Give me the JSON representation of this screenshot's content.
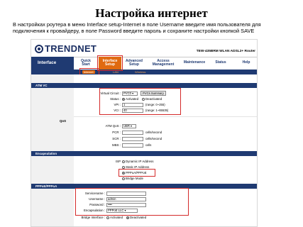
{
  "slide": {
    "title": "Настройка интернет",
    "description_line1": "В настройках роутера в меню Interface setup-Internet  в поле Username введите имя пользователя для",
    "description_line2": "подключения к  провайдеру, в поле Password  введите пароль и сохраните настройки кнопкой SAVE"
  },
  "router": {
    "brand": "TRENDNET",
    "model": "TEW-435BRM WLAN ADSL2+ Router",
    "nav_left": "Interface",
    "tabs": [
      {
        "label_line1": "Quick",
        "label_line2": "Start"
      },
      {
        "label_line1": "Interface",
        "label_line2": "Setup"
      },
      {
        "label_line1": "Advanced",
        "label_line2": "Setup"
      },
      {
        "label_line1": "Access",
        "label_line2": "Management"
      },
      {
        "label_line1": "Maintenance",
        "label_line2": ""
      },
      {
        "label_line1": "Status",
        "label_line2": ""
      },
      {
        "label_line1": "Help",
        "label_line2": ""
      }
    ],
    "subtabs": [
      "Internet",
      "LAN",
      "Wireless"
    ],
    "sections": {
      "atm_vc": "ATM VC",
      "qos": "QoS",
      "encapsulation": "Encapsulation",
      "pppoe": "PPPoE/PPPoA"
    },
    "atm": {
      "virtual_circuit_label": "Virtual Circuit :",
      "virtual_circuit_value": "PVC0",
      "pvcs_summary_button": "PVCs Summary",
      "status_label": "Status :",
      "status_activated": "Activated",
      "status_deactivated": "Deactivated",
      "vpi_label": "VPI :",
      "vpi_value": "1",
      "vpi_hint": "(range: 0~255)",
      "vci_label": "VCI :",
      "vci_value": "40",
      "vci_hint": "(range: 1~65535)"
    },
    "qos": {
      "atm_qos_label": "ATM QoS :",
      "atm_qos_value": "UBR",
      "pcr_label": "PCR :",
      "pcr_unit": "cells/second",
      "scr_label": "SCR :",
      "scr_unit": "cells/second",
      "mbs_label": "MBS :",
      "mbs_unit": "cells"
    },
    "encap": {
      "isp_label": "ISP",
      "options": [
        "Dynamic IP Address",
        "Static IP Address",
        "PPPoA/PPPoE",
        "Bridge Mode"
      ]
    },
    "pppoe": {
      "servicename_label": "Servicename :",
      "servicename_value": "",
      "username_label": "Username :",
      "username_value": "admin",
      "password_label": "Password :",
      "password_value": "••••",
      "encapsulation_label": "Encapsulation :",
      "encapsulation_value": "PPPoE LLC",
      "bridge_label": "Bridge Interface :",
      "bridge_activated": "Activated",
      "bridge_deactivated": "Deactivated"
    }
  }
}
